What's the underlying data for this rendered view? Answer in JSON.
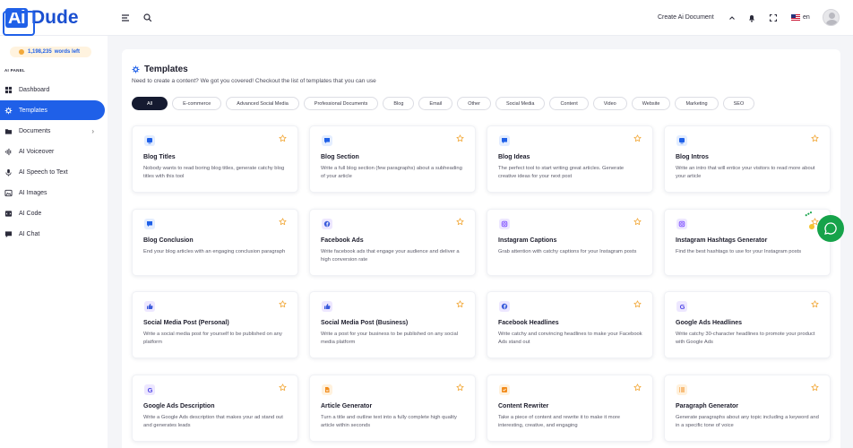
{
  "header": {
    "logo_ai": "Ai",
    "logo_dude": "Dude",
    "create_doc_label": "Create Ai Document",
    "language": "en"
  },
  "sidebar": {
    "words_count": "1,198,235",
    "words_label": "words left",
    "section_heading": "AI PANEL",
    "items": [
      {
        "label": "Dashboard"
      },
      {
        "label": "Templates"
      },
      {
        "label": "Documents"
      },
      {
        "label": "AI Voiceover"
      },
      {
        "label": "AI Speech to Text"
      },
      {
        "label": "AI Images"
      },
      {
        "label": "AI Code"
      },
      {
        "label": "AI Chat"
      }
    ]
  },
  "main": {
    "title": "Templates",
    "subtitle": "Need to create a content? We got you covered! Checkout the list of templates that you can use",
    "filters": [
      "All",
      "E-commerce",
      "Advanced Social Media",
      "Professional Documents",
      "Blog",
      "Email",
      "Other",
      "Social Media",
      "Content",
      "Video",
      "Website",
      "Marketing",
      "SEO"
    ],
    "cards": [
      {
        "title": "Blog Titles",
        "desc": "Nobody wants to read boring blog titles, generate catchy blog titles with this tool"
      },
      {
        "title": "Blog Section",
        "desc": "Write a full blog section (few paragraphs) about a subheading of your article"
      },
      {
        "title": "Blog Ideas",
        "desc": "The perfect tool to start writing great articles. Generate creative ideas for your next post"
      },
      {
        "title": "Blog Intros",
        "desc": "Write an intro that will entice your visitors to read more about your article"
      },
      {
        "title": "Blog Conclusion",
        "desc": "End your blog articles with an engaging conclusion paragraph"
      },
      {
        "title": "Facebook Ads",
        "desc": "Write facebook ads that engage your audience and deliver a high conversion rate"
      },
      {
        "title": "Instagram Captions",
        "desc": "Grab attention with catchy captions for your Instagram posts"
      },
      {
        "title": "Instagram Hashtags Generator",
        "desc": "Find the best hashtags to use for your Instagram posts"
      },
      {
        "title": "Social Media Post (Personal)",
        "desc": "Write a social media post for yourself to be published on any platform"
      },
      {
        "title": "Social Media Post (Business)",
        "desc": "Write a post for your business to be published on any social media platform"
      },
      {
        "title": "Facebook Headlines",
        "desc": "Write catchy and convincing headlines to make your Facebook Ads stand out"
      },
      {
        "title": "Google Ads Headlines",
        "desc": "Write catchy 30-character headlines to promote your product with Google Ads"
      },
      {
        "title": "Google Ads Description",
        "desc": "Write a Google Ads description that makes your ad stand out and generates leads"
      },
      {
        "title": "Article Generator",
        "desc": "Turn a title and outline text into a fully complete high quality article within seconds"
      },
      {
        "title": "Content Rewriter",
        "desc": "Take a piece of content and rewrite it to make it more interesting, creative, and engaging"
      },
      {
        "title": "Paragraph Generator",
        "desc": "Generate paragraphs about any topic including a keyword and in a specific tone of voice"
      }
    ]
  },
  "colors": {
    "accent": "#1f60e8",
    "star": "#f2a93b",
    "chat": "#16a34a"
  }
}
